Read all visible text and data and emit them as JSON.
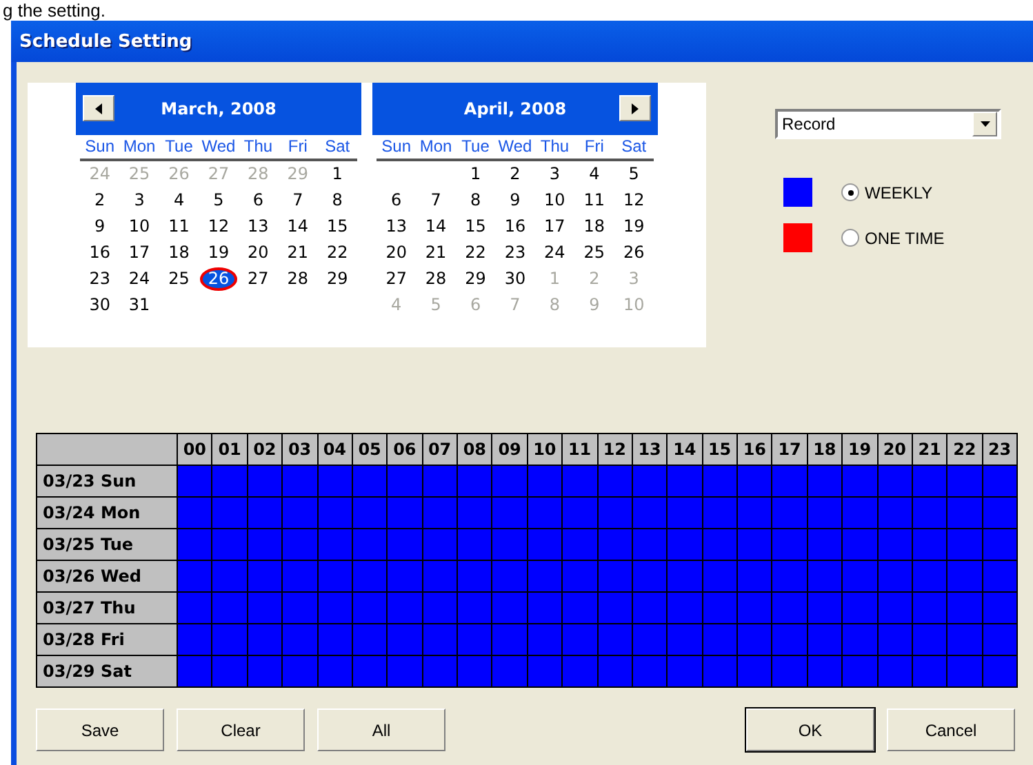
{
  "doc_text": "g the setting.",
  "window": {
    "title": "Schedule Setting"
  },
  "calendars": [
    {
      "month": "March, 2008",
      "has_prev": true,
      "has_next": false,
      "weekdays": [
        "Sun",
        "Mon",
        "Tue",
        "Wed",
        "Thu",
        "Fri",
        "Sat"
      ],
      "weeks": [
        [
          {
            "day": "24",
            "outside": true,
            "selected": false
          },
          {
            "day": "25",
            "outside": true,
            "selected": false
          },
          {
            "day": "26",
            "outside": true,
            "selected": false
          },
          {
            "day": "27",
            "outside": true,
            "selected": false
          },
          {
            "day": "28",
            "outside": true,
            "selected": false
          },
          {
            "day": "29",
            "outside": true,
            "selected": false
          },
          {
            "day": "1",
            "outside": false,
            "selected": false
          }
        ],
        [
          {
            "day": "2",
            "outside": false,
            "selected": false
          },
          {
            "day": "3",
            "outside": false,
            "selected": false
          },
          {
            "day": "4",
            "outside": false,
            "selected": false
          },
          {
            "day": "5",
            "outside": false,
            "selected": false
          },
          {
            "day": "6",
            "outside": false,
            "selected": false
          },
          {
            "day": "7",
            "outside": false,
            "selected": false
          },
          {
            "day": "8",
            "outside": false,
            "selected": false
          }
        ],
        [
          {
            "day": "9",
            "outside": false,
            "selected": false
          },
          {
            "day": "10",
            "outside": false,
            "selected": false
          },
          {
            "day": "11",
            "outside": false,
            "selected": false
          },
          {
            "day": "12",
            "outside": false,
            "selected": false
          },
          {
            "day": "13",
            "outside": false,
            "selected": false
          },
          {
            "day": "14",
            "outside": false,
            "selected": false
          },
          {
            "day": "15",
            "outside": false,
            "selected": false
          }
        ],
        [
          {
            "day": "16",
            "outside": false,
            "selected": false
          },
          {
            "day": "17",
            "outside": false,
            "selected": false
          },
          {
            "day": "18",
            "outside": false,
            "selected": false
          },
          {
            "day": "19",
            "outside": false,
            "selected": false
          },
          {
            "day": "20",
            "outside": false,
            "selected": false
          },
          {
            "day": "21",
            "outside": false,
            "selected": false
          },
          {
            "day": "22",
            "outside": false,
            "selected": false
          }
        ],
        [
          {
            "day": "23",
            "outside": false,
            "selected": false
          },
          {
            "day": "24",
            "outside": false,
            "selected": false
          },
          {
            "day": "25",
            "outside": false,
            "selected": false
          },
          {
            "day": "26",
            "outside": false,
            "selected": true
          },
          {
            "day": "27",
            "outside": false,
            "selected": false
          },
          {
            "day": "28",
            "outside": false,
            "selected": false
          },
          {
            "day": "29",
            "outside": false,
            "selected": false
          }
        ],
        [
          {
            "day": "30",
            "outside": false,
            "selected": false
          },
          {
            "day": "31",
            "outside": false,
            "selected": false
          }
        ]
      ]
    },
    {
      "month": "April, 2008",
      "has_prev": false,
      "has_next": true,
      "weekdays": [
        "Sun",
        "Mon",
        "Tue",
        "Wed",
        "Thu",
        "Fri",
        "Sat"
      ],
      "weeks": [
        [
          {
            "day": "1",
            "outside": false,
            "selected": false
          },
          {
            "day": "2",
            "outside": false,
            "selected": false
          },
          {
            "day": "3",
            "outside": false,
            "selected": false
          },
          {
            "day": "4",
            "outside": false,
            "selected": false
          },
          {
            "day": "5",
            "outside": false,
            "selected": false
          }
        ],
        [
          {
            "day": "6",
            "outside": false,
            "selected": false
          },
          {
            "day": "7",
            "outside": false,
            "selected": false
          },
          {
            "day": "8",
            "outside": false,
            "selected": false
          },
          {
            "day": "9",
            "outside": false,
            "selected": false
          },
          {
            "day": "10",
            "outside": false,
            "selected": false
          },
          {
            "day": "11",
            "outside": false,
            "selected": false
          },
          {
            "day": "12",
            "outside": false,
            "selected": false
          }
        ],
        [
          {
            "day": "13",
            "outside": false,
            "selected": false
          },
          {
            "day": "14",
            "outside": false,
            "selected": false
          },
          {
            "day": "15",
            "outside": false,
            "selected": false
          },
          {
            "day": "16",
            "outside": false,
            "selected": false
          },
          {
            "day": "17",
            "outside": false,
            "selected": false
          },
          {
            "day": "18",
            "outside": false,
            "selected": false
          },
          {
            "day": "19",
            "outside": false,
            "selected": false
          }
        ],
        [
          {
            "day": "20",
            "outside": false,
            "selected": false
          },
          {
            "day": "21",
            "outside": false,
            "selected": false
          },
          {
            "day": "22",
            "outside": false,
            "selected": false
          },
          {
            "day": "23",
            "outside": false,
            "selected": false
          },
          {
            "day": "24",
            "outside": false,
            "selected": false
          },
          {
            "day": "25",
            "outside": false,
            "selected": false
          },
          {
            "day": "26",
            "outside": false,
            "selected": false
          }
        ],
        [
          {
            "day": "27",
            "outside": false,
            "selected": false
          },
          {
            "day": "28",
            "outside": false,
            "selected": false
          },
          {
            "day": "29",
            "outside": false,
            "selected": false
          },
          {
            "day": "30",
            "outside": false,
            "selected": false
          },
          {
            "day": "1",
            "outside": true,
            "selected": false
          },
          {
            "day": "2",
            "outside": true,
            "selected": false
          },
          {
            "day": "3",
            "outside": true,
            "selected": false
          }
        ],
        [
          {
            "day": "4",
            "outside": true,
            "selected": false
          },
          {
            "day": "5",
            "outside": true,
            "selected": false
          },
          {
            "day": "6",
            "outside": true,
            "selected": false
          },
          {
            "day": "7",
            "outside": true,
            "selected": false
          },
          {
            "day": "8",
            "outside": true,
            "selected": false
          },
          {
            "day": "9",
            "outside": true,
            "selected": false
          },
          {
            "day": "10",
            "outside": true,
            "selected": false
          }
        ]
      ]
    }
  ],
  "mode_select": {
    "value": "Record"
  },
  "legend": [
    {
      "label": "WEEKLY",
      "color": "#0000ff",
      "selected": true
    },
    {
      "label": "ONE TIME",
      "color": "#ff0000",
      "selected": false
    }
  ],
  "schedule": {
    "hours": [
      "00",
      "01",
      "02",
      "03",
      "04",
      "05",
      "06",
      "07",
      "08",
      "09",
      "10",
      "11",
      "12",
      "13",
      "14",
      "15",
      "16",
      "17",
      "18",
      "19",
      "20",
      "21",
      "22",
      "23"
    ],
    "rows": [
      {
        "label": "03/23 Sun",
        "slots": [
          {
            "color": "#0000ff"
          },
          {
            "color": "#0000ff"
          },
          {
            "color": "#0000ff"
          },
          {
            "color": "#0000ff"
          },
          {
            "color": "#0000ff"
          },
          {
            "color": "#0000ff"
          },
          {
            "color": "#0000ff"
          },
          {
            "color": "#0000ff"
          },
          {
            "color": "#0000ff"
          },
          {
            "color": "#0000ff"
          },
          {
            "color": "#0000ff"
          },
          {
            "color": "#0000ff"
          },
          {
            "color": "#0000ff"
          },
          {
            "color": "#0000ff"
          },
          {
            "color": "#0000ff"
          },
          {
            "color": "#0000ff"
          },
          {
            "color": "#0000ff"
          },
          {
            "color": "#0000ff"
          },
          {
            "color": "#0000ff"
          },
          {
            "color": "#0000ff"
          },
          {
            "color": "#0000ff"
          },
          {
            "color": "#0000ff"
          },
          {
            "color": "#0000ff"
          },
          {
            "color": "#0000ff"
          }
        ]
      },
      {
        "label": "03/24 Mon",
        "slots": [
          {
            "color": "#0000ff"
          },
          {
            "color": "#0000ff"
          },
          {
            "color": "#0000ff"
          },
          {
            "color": "#0000ff"
          },
          {
            "color": "#0000ff"
          },
          {
            "color": "#0000ff"
          },
          {
            "color": "#0000ff"
          },
          {
            "color": "#0000ff"
          },
          {
            "color": "#0000ff"
          },
          {
            "color": "#0000ff"
          },
          {
            "color": "#0000ff"
          },
          {
            "color": "#0000ff"
          },
          {
            "color": "#0000ff"
          },
          {
            "color": "#0000ff"
          },
          {
            "color": "#0000ff"
          },
          {
            "color": "#0000ff"
          },
          {
            "color": "#0000ff"
          },
          {
            "color": "#0000ff"
          },
          {
            "color": "#0000ff"
          },
          {
            "color": "#0000ff"
          },
          {
            "color": "#0000ff"
          },
          {
            "color": "#0000ff"
          },
          {
            "color": "#0000ff"
          },
          {
            "color": "#0000ff"
          }
        ]
      },
      {
        "label": "03/25 Tue",
        "slots": [
          {
            "color": "#0000ff"
          },
          {
            "color": "#0000ff"
          },
          {
            "color": "#0000ff"
          },
          {
            "color": "#0000ff"
          },
          {
            "color": "#0000ff"
          },
          {
            "color": "#0000ff"
          },
          {
            "color": "#0000ff"
          },
          {
            "color": "#0000ff"
          },
          {
            "color": "#0000ff"
          },
          {
            "color": "#0000ff"
          },
          {
            "color": "#0000ff"
          },
          {
            "color": "#0000ff"
          },
          {
            "color": "#0000ff"
          },
          {
            "color": "#0000ff"
          },
          {
            "color": "#0000ff"
          },
          {
            "color": "#0000ff"
          },
          {
            "color": "#0000ff"
          },
          {
            "color": "#0000ff"
          },
          {
            "color": "#0000ff"
          },
          {
            "color": "#0000ff"
          },
          {
            "color": "#0000ff"
          },
          {
            "color": "#0000ff"
          },
          {
            "color": "#0000ff"
          },
          {
            "color": "#0000ff"
          }
        ]
      },
      {
        "label": "03/26 Wed",
        "slots": [
          {
            "color": "#0000ff"
          },
          {
            "color": "#0000ff"
          },
          {
            "color": "#0000ff"
          },
          {
            "color": "#0000ff"
          },
          {
            "color": "#0000ff"
          },
          {
            "color": "#0000ff"
          },
          {
            "color": "#0000ff"
          },
          {
            "color": "#0000ff"
          },
          {
            "color": "#0000ff"
          },
          {
            "color": "#0000ff"
          },
          {
            "color": "#0000ff"
          },
          {
            "color": "#0000ff"
          },
          {
            "color": "#0000ff"
          },
          {
            "color": "#0000ff"
          },
          {
            "color": "#0000ff"
          },
          {
            "color": "#0000ff"
          },
          {
            "color": "#0000ff"
          },
          {
            "color": "#0000ff"
          },
          {
            "color": "#0000ff"
          },
          {
            "color": "#0000ff"
          },
          {
            "color": "#0000ff"
          },
          {
            "color": "#0000ff"
          },
          {
            "color": "#0000ff"
          },
          {
            "color": "#0000ff"
          }
        ]
      },
      {
        "label": "03/27 Thu",
        "slots": [
          {
            "color": "#0000ff"
          },
          {
            "color": "#0000ff"
          },
          {
            "color": "#0000ff"
          },
          {
            "color": "#0000ff"
          },
          {
            "color": "#0000ff"
          },
          {
            "color": "#0000ff"
          },
          {
            "color": "#0000ff"
          },
          {
            "color": "#0000ff"
          },
          {
            "color": "#0000ff"
          },
          {
            "color": "#0000ff"
          },
          {
            "color": "#0000ff"
          },
          {
            "color": "#0000ff"
          },
          {
            "color": "#0000ff"
          },
          {
            "color": "#0000ff"
          },
          {
            "color": "#0000ff"
          },
          {
            "color": "#0000ff"
          },
          {
            "color": "#0000ff"
          },
          {
            "color": "#0000ff"
          },
          {
            "color": "#0000ff"
          },
          {
            "color": "#0000ff"
          },
          {
            "color": "#0000ff"
          },
          {
            "color": "#0000ff"
          },
          {
            "color": "#0000ff"
          },
          {
            "color": "#0000ff"
          }
        ]
      },
      {
        "label": "03/28 Fri",
        "slots": [
          {
            "color": "#0000ff"
          },
          {
            "color": "#0000ff"
          },
          {
            "color": "#0000ff"
          },
          {
            "color": "#0000ff"
          },
          {
            "color": "#0000ff"
          },
          {
            "color": "#0000ff"
          },
          {
            "color": "#0000ff"
          },
          {
            "color": "#0000ff"
          },
          {
            "color": "#0000ff"
          },
          {
            "color": "#0000ff"
          },
          {
            "color": "#0000ff"
          },
          {
            "color": "#0000ff"
          },
          {
            "color": "#0000ff"
          },
          {
            "color": "#0000ff"
          },
          {
            "color": "#0000ff"
          },
          {
            "color": "#0000ff"
          },
          {
            "color": "#0000ff"
          },
          {
            "color": "#0000ff"
          },
          {
            "color": "#0000ff"
          },
          {
            "color": "#0000ff"
          },
          {
            "color": "#0000ff"
          },
          {
            "color": "#0000ff"
          },
          {
            "color": "#0000ff"
          },
          {
            "color": "#0000ff"
          }
        ]
      },
      {
        "label": "03/29 Sat",
        "slots": [
          {
            "color": "#0000ff"
          },
          {
            "color": "#0000ff"
          },
          {
            "color": "#0000ff"
          },
          {
            "color": "#0000ff"
          },
          {
            "color": "#0000ff"
          },
          {
            "color": "#0000ff"
          },
          {
            "color": "#0000ff"
          },
          {
            "color": "#0000ff"
          },
          {
            "color": "#0000ff"
          },
          {
            "color": "#0000ff"
          },
          {
            "color": "#0000ff"
          },
          {
            "color": "#0000ff"
          },
          {
            "color": "#0000ff"
          },
          {
            "color": "#0000ff"
          },
          {
            "color": "#0000ff"
          },
          {
            "color": "#0000ff"
          },
          {
            "color": "#0000ff"
          },
          {
            "color": "#0000ff"
          },
          {
            "color": "#0000ff"
          },
          {
            "color": "#0000ff"
          },
          {
            "color": "#0000ff"
          },
          {
            "color": "#0000ff"
          },
          {
            "color": "#0000ff"
          },
          {
            "color": "#0000ff"
          }
        ]
      }
    ]
  },
  "buttons_left": [
    "Save",
    "Clear",
    "All"
  ],
  "buttons_right": [
    {
      "label": "OK",
      "default": true
    },
    {
      "label": "Cancel",
      "default": false
    }
  ]
}
